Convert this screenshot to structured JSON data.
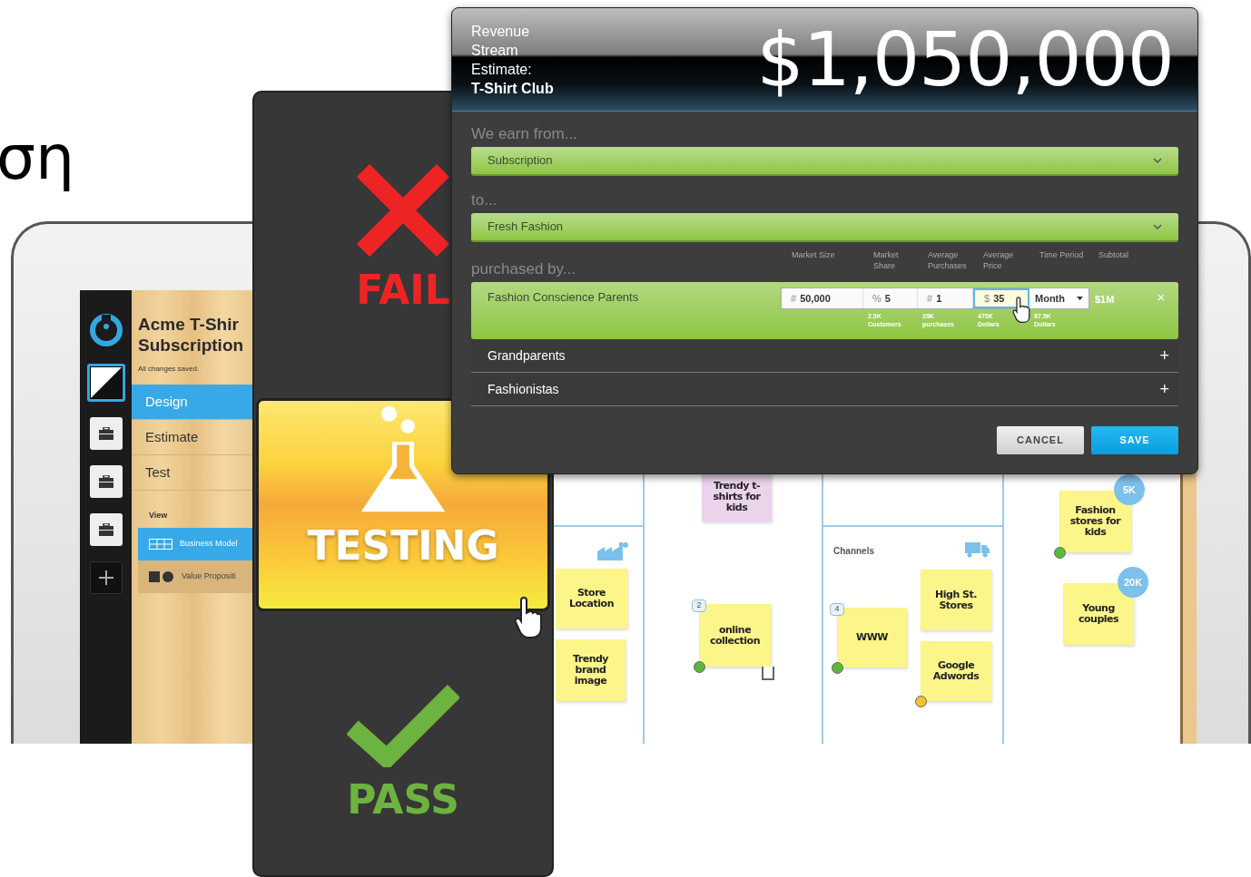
{
  "background_text": "ση",
  "app": {
    "title_lines": [
      "Acme T-Shir",
      "Subscription"
    ],
    "save_status": "All changes saved.",
    "tools": [
      {
        "kind": "thumbnail",
        "selected": true
      },
      {
        "kind": "briefcase",
        "selected": false
      },
      {
        "kind": "briefcase",
        "selected": false
      },
      {
        "kind": "briefcase",
        "selected": false
      },
      {
        "kind": "add",
        "selected": false
      }
    ],
    "nav": [
      {
        "label": "Design",
        "selected": true
      },
      {
        "label": "Estimate",
        "selected": false
      },
      {
        "label": "Test",
        "selected": false
      }
    ],
    "view_label": "View",
    "views": [
      {
        "label": "Business Model",
        "kind": "grid",
        "selected": true
      },
      {
        "label": "Value Propositi",
        "kind": "shapes",
        "selected": false
      }
    ],
    "board": {
      "section_label": "Channels",
      "notes": [
        {
          "text": "Trendy t-shirts for kids",
          "color": "#ecd3ec"
        },
        {
          "text": "Store Location",
          "color": "#fbf58a"
        },
        {
          "text": "Trendy brand image",
          "color": "#fbf58a"
        },
        {
          "text": "online collection",
          "color": "#fbf58a",
          "badge": "2",
          "marker": {
            "color": "#5cb83a"
          },
          "checkbox": {
            "checked": false
          }
        },
        {
          "text": "WWW",
          "color": "#fbf58a",
          "badge": "4",
          "marker": {
            "color": "#5cb83a"
          }
        },
        {
          "text": "High St. Stores",
          "color": "#fbf58a"
        },
        {
          "text": "Google Adwords",
          "color": "#fbf58a",
          "marker": {
            "color": "#f2c12e"
          }
        },
        {
          "text": "Fashion stores for kids",
          "color": "#fbf58a",
          "bubble": "5K",
          "marker": {
            "color": "#5cb83a"
          }
        },
        {
          "text": "Young couples",
          "color": "#fbf58a",
          "bubble": "20K"
        }
      ]
    }
  },
  "stages": [
    {
      "kind": "fail",
      "label": "FAIL",
      "selected": false
    },
    {
      "kind": "testing",
      "label": "TESTING",
      "selected": true
    },
    {
      "kind": "pass",
      "label": "PASS",
      "selected": false
    }
  ],
  "dialog": {
    "title_lines": [
      "Revenue",
      "Stream",
      "Estimate:"
    ],
    "title_name": "T-Shirt Club",
    "amount": "$1,050,000",
    "earn_label": "We earn from...",
    "earn_value": "Subscription",
    "to_label": "to...",
    "to_value": "Fresh Fashion",
    "purchased_label": "purchased by...",
    "columns": [
      "Market Size",
      "Market Share",
      "Average Purchases",
      "Average Price",
      "Time Period",
      "Subtotal"
    ],
    "segments": [
      {
        "name": "Fashion Conscience Parents",
        "expanded": true,
        "fields": [
          {
            "prefix": "#",
            "value": "50,000",
            "focused": false
          },
          {
            "prefix": "%",
            "value": "5",
            "focused": false,
            "note": [
              "2.5K",
              "Customers"
            ]
          },
          {
            "prefix": "#",
            "value": "1",
            "focused": false,
            "note": [
              "25K",
              "purchases"
            ]
          },
          {
            "prefix": "$",
            "value": "35",
            "focused": true,
            "note": [
              "475K",
              "Dollars"
            ]
          }
        ],
        "period": "Month",
        "period_note": [
          "87.5K",
          "Dollars"
        ],
        "subtotal": "$1M",
        "remove": "×"
      },
      {
        "name": "Grandparents",
        "expanded": false,
        "add": "+"
      },
      {
        "name": "Fashionistas",
        "expanded": false,
        "add": "+"
      }
    ],
    "buttons": [
      {
        "label": "CANCEL",
        "kind": "secondary"
      },
      {
        "label": "SAVE",
        "kind": "primary"
      }
    ]
  }
}
